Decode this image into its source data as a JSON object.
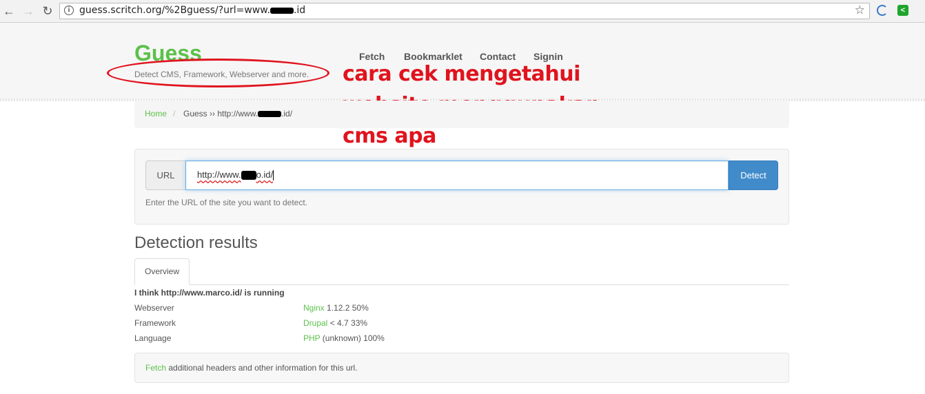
{
  "browser": {
    "url_prefix": "guess.scritch.org/%2Bguess/?url=www.",
    "url_suffix": ".id",
    "back_glyph": "←",
    "forward_glyph": "→",
    "reload_glyph": "↻",
    "star_glyph": "☆"
  },
  "header": {
    "brand": "Guess",
    "tagline": "Detect CMS, Framework, Webserver and more."
  },
  "nav": {
    "items": [
      "Fetch",
      "Bookmarklet",
      "Contact",
      "Signin"
    ]
  },
  "annotation": {
    "lines": [
      "cara cek mengetahui",
      "website menggunakan",
      "cms apa"
    ],
    "color": "#e0141e"
  },
  "breadcrumb": {
    "home": "Home",
    "separator": "/",
    "current_prefix": "Guess ›› http://www.",
    "current_suffix": ".id/"
  },
  "form": {
    "addon_label": "URL",
    "input_prefix": "http://www.",
    "input_suffix": "o.id/",
    "button": "Detect",
    "help": "Enter the URL of the site you want to detect."
  },
  "results": {
    "title": "Detection results",
    "tab": "Overview",
    "summary": "I think http://www.marco.id/ is running",
    "rows": [
      {
        "label": "Webserver",
        "name": "Nginx",
        "detail": " 1.12.2 50%"
      },
      {
        "label": "Framework",
        "name": "Drupal",
        "detail": " < 4.7 33%"
      },
      {
        "label": "Language",
        "name": "PHP",
        "detail": " (unknown) 100%"
      }
    ],
    "fetch_link": "Fetch",
    "fetch_text": " additional headers and other information for this url."
  },
  "colors": {
    "accent_green": "#5cc14a",
    "button_blue": "#428bca"
  }
}
